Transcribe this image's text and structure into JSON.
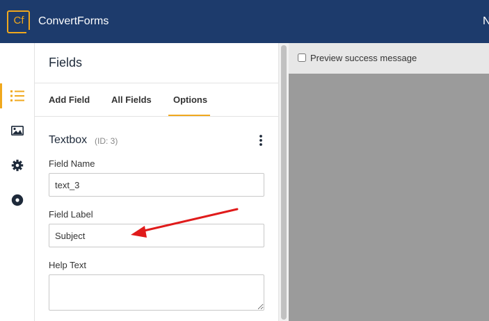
{
  "app": {
    "logo_text": "Cf",
    "title": "ConvertForms",
    "top_right_text": "N"
  },
  "sidebar_icons": [
    "list-icon",
    "image-icon",
    "gear-icon",
    "record-icon"
  ],
  "panel": {
    "title": "Fields",
    "tabs": [
      {
        "label": "Add Field",
        "active": false
      },
      {
        "label": "All Fields",
        "active": false
      },
      {
        "label": "Options",
        "active": true
      }
    ],
    "field_type": "Textbox",
    "field_id": "(ID: 3)",
    "field_name_label": "Field Name",
    "field_name_value": "text_3",
    "field_label_label": "Field Label",
    "field_label_value": "Subject",
    "help_text_label": "Help Text",
    "help_text_value": ""
  },
  "preview": {
    "checkbox_label": "Preview success message",
    "checked": false
  },
  "colors": {
    "header": "#1d3b6c",
    "accent": "#f0a81d",
    "arrow": "#e01b1b",
    "preview_bg": "#9b9b9b"
  }
}
